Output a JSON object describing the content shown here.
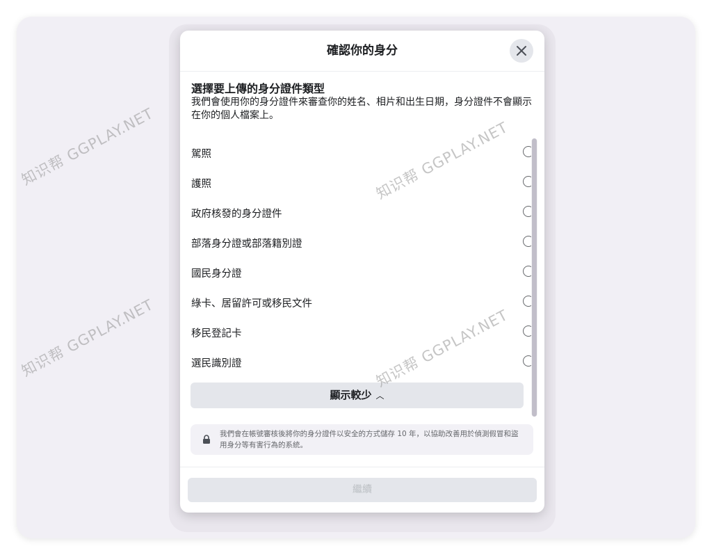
{
  "modal": {
    "title": "確認你的身分",
    "section_title": "選擇要上傳的身分證件類型",
    "section_desc": "我們會使用你的身分證件來審查你的姓名、相片和出生日期，身分證件不會顯示在你的個人檔案上。",
    "options": [
      {
        "label": "駕照"
      },
      {
        "label": "護照"
      },
      {
        "label": "政府核發的身分證件"
      },
      {
        "label": "部落身分證或部落籍別證"
      },
      {
        "label": "國民身分證"
      },
      {
        "label": "綠卡、居留許可或移民文件"
      },
      {
        "label": "移民登記卡"
      },
      {
        "label": "選民識別證"
      }
    ],
    "show_less_label": "顯示較少",
    "show_less_icon": "chevron-up-icon",
    "notice_text": "我們會在帳號審核後將你的身分證件以安全的方式儲存 10 年，以協助改善用於偵測假冒和盜用身分等有害行為的系統。",
    "notice_icon": "lock-icon",
    "continue_label": "繼續",
    "close_icon": "close-icon"
  },
  "watermark": {
    "text": "知识帮 GGPLAY.NET"
  },
  "colors": {
    "backdrop": "#f1eff5",
    "button_bg": "#e4e6eb",
    "text_primary": "#1c1e21",
    "text_secondary": "#65676b",
    "disabled_text": "#bcc0c4"
  }
}
